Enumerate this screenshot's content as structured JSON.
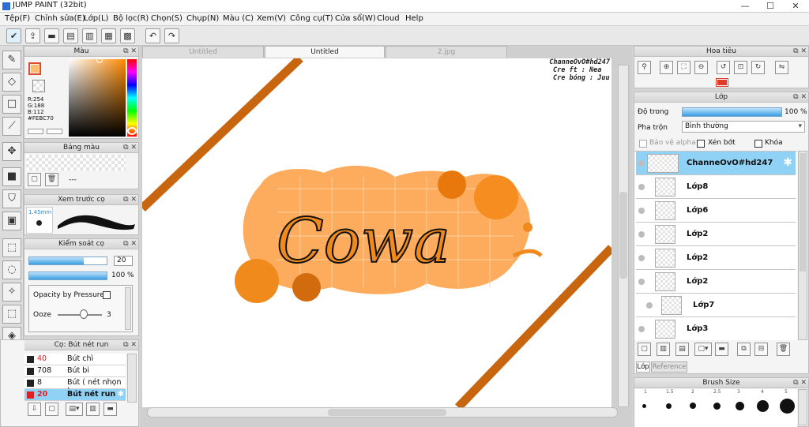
{
  "app": {
    "title": "JUMP PAINT (32bit)",
    "win_min": "—",
    "win_max": "☐",
    "win_close": "✕"
  },
  "menu": [
    "Tệp(F)",
    "Chỉnh sửa(E)",
    "Lớp(L)",
    "Bộ lọc(R)",
    "Chọn(S)",
    "Chụp(N)",
    "Màu (C)",
    "Xem(V)",
    "Công cụ(T)",
    "Cửa sổ(W)",
    "Cloud",
    "Help"
  ],
  "color_panel": {
    "title": "Màu",
    "r": "R:254",
    "g": "G:188",
    "b": "B:112",
    "hex": "#FEBC70",
    "current": "#FEBC70"
  },
  "swatch_panel": {
    "title": "Bảng màu",
    "value": "---"
  },
  "preview_panel": {
    "title": "Xem trước cọ",
    "size": "1.45mm"
  },
  "brush_control": {
    "title": "Kiểm soát cọ",
    "size_value": "20",
    "opacity_value": "100 %",
    "opacity_fraction": 1.0,
    "opacity_by_pressure": "Opacity by Pressure",
    "ooze_label": "Ooze",
    "ooze_value": "3"
  },
  "brush_list": {
    "title": "Cọ: Bút nét run",
    "items": [
      {
        "size": "40",
        "name": "Bút chì",
        "size_color": "#e02020"
      },
      {
        "size": "708",
        "name": "Bút bi",
        "size_color": "#111111"
      },
      {
        "size": "8",
        "name": "Bút ( nét nhọn )",
        "size_color": "#111111"
      },
      {
        "size": "20",
        "name": "Bút nét run",
        "size_color": "#e02020"
      }
    ]
  },
  "tabs": [
    "Untitled",
    "Untitled",
    "2.jpg"
  ],
  "canvas": {
    "credits": [
      "ChanneOvO#hd247",
      "Cre ft : Nea",
      "Cre bóng : Juu"
    ],
    "artwork_text": "Cowa"
  },
  "navigator": {
    "title": "Hoa tiêu"
  },
  "layer_panel": {
    "title": "Lớp",
    "opacity_label": "Độ trong",
    "opacity_value": "100 %",
    "opacity_fraction": 1.0,
    "blend_label": "Pha trộn",
    "blend_value": "Bình thường",
    "protect_alpha": "Bảo vệ alpha",
    "clipping": "Xén bớt",
    "lock": "Khóa",
    "layers": [
      "ChanneOvO#hd247",
      "Lớp8",
      "Lớp6",
      "Lớp2",
      "Lớp2",
      "Lớp2",
      "Lớp7",
      "Lớp3"
    ],
    "tab_layer": "Lớp",
    "tab_reference": "Reference"
  },
  "brush_size_panel": {
    "title": "Brush Size",
    "labels": [
      "1",
      "1.5",
      "2",
      "2.5",
      "3",
      "4",
      "5"
    ]
  },
  "colors": {
    "accent": "#2a8de0",
    "orange": "#f08a1c",
    "selected_layer": "#8fd2f5"
  }
}
